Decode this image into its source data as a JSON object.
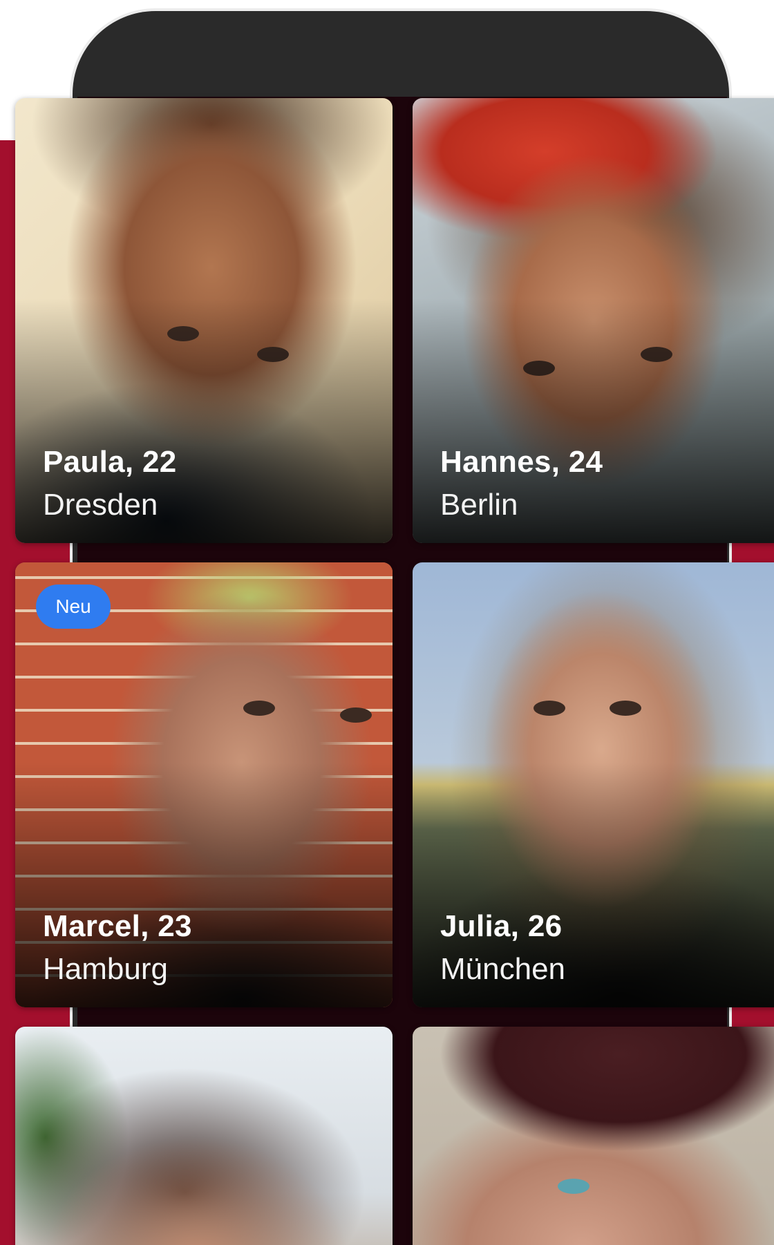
{
  "profiles": [
    {
      "name_age": "Paula, 22",
      "city": "Dresden",
      "badge": ""
    },
    {
      "name_age": "Hannes, 24",
      "city": "Berlin",
      "badge": ""
    },
    {
      "name_age": "Marcel, 23",
      "city": "Hamburg",
      "badge": "Neu"
    },
    {
      "name_age": "Julia, 26",
      "city": "München",
      "badge": ""
    },
    {
      "name_age": "",
      "city": "",
      "badge": ""
    },
    {
      "name_age": "",
      "city": "",
      "badge": ""
    }
  ],
  "colors": {
    "brand_band": "#a30f2d",
    "phone_frame": "#2a2a2a",
    "screen_bg": "#1c040b",
    "badge_blue": "#2f7cf0",
    "text_white": "#ffffff"
  }
}
